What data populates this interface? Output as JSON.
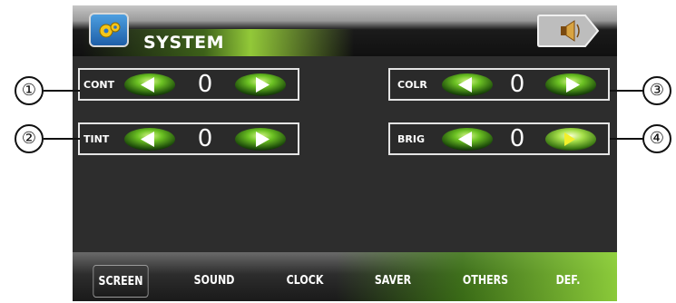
{
  "header": {
    "title": "SYSTEM",
    "app_icon": "gear-settings-icon",
    "speaker_icon": "speaker-icon"
  },
  "settings": [
    {
      "id": "cont",
      "label": "CONT",
      "value": "0",
      "callout": "①"
    },
    {
      "id": "tint",
      "label": "TINT",
      "value": "0",
      "callout": "②"
    },
    {
      "id": "colr",
      "label": "COLR",
      "value": "0",
      "callout": "③"
    },
    {
      "id": "brig",
      "label": "BRIG",
      "value": "0",
      "callout": "④"
    }
  ],
  "tabs": [
    {
      "label": "SCREEN",
      "active": true
    },
    {
      "label": "SOUND",
      "active": false
    },
    {
      "label": "CLOCK",
      "active": false
    },
    {
      "label": "SAVER",
      "active": false
    },
    {
      "label": "OTHERS",
      "active": false
    },
    {
      "label": "DEF.",
      "active": false
    }
  ],
  "colors": {
    "accent_green": "#8fd63c",
    "highlight_yellow": "#f2ef2a",
    "panel_border": "#e4e4e4",
    "background": "#2d2d2d"
  }
}
